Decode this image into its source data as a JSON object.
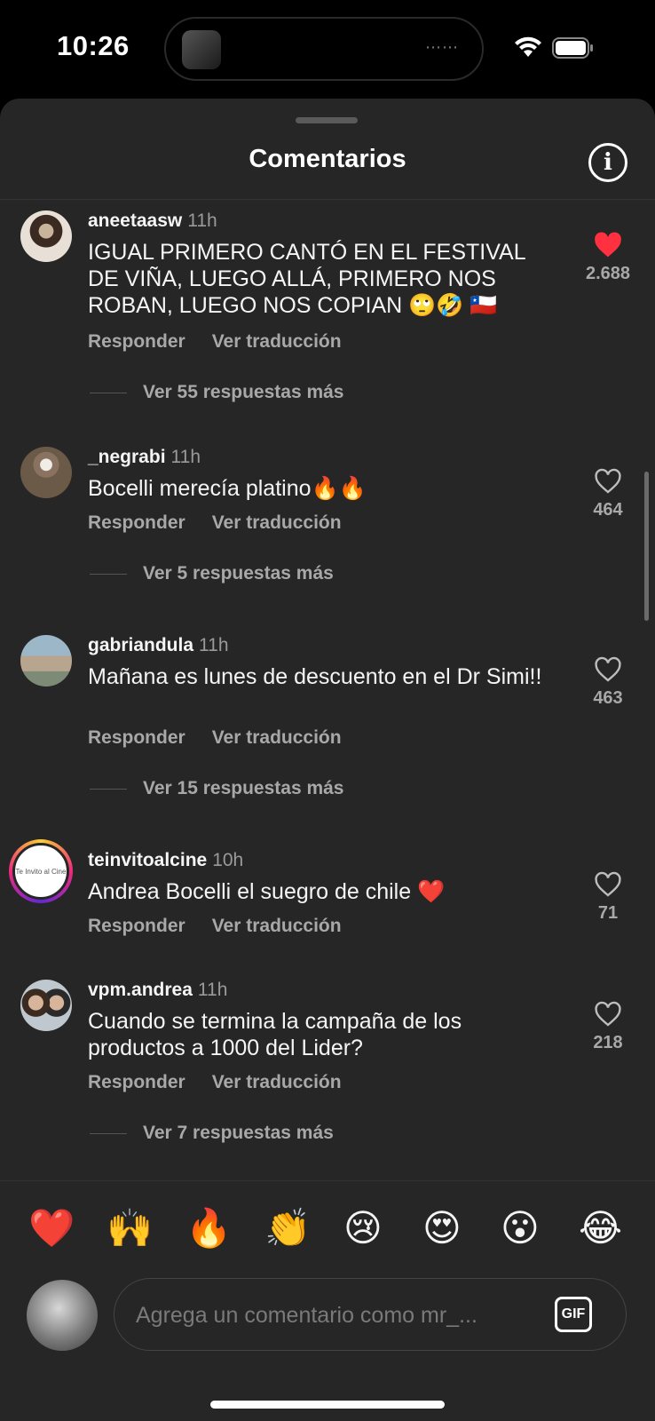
{
  "status": {
    "time": "10:26"
  },
  "sheet": {
    "title": "Comentarios"
  },
  "comments": [
    {
      "username": "aneetaasw",
      "time": "11h",
      "text": "IGUAL PRIMERO CANTÓ EN EL FESTIVAL DE VIÑA, LUEGO ALLÁ, PRIMERO NOS ROBAN, LUEGO NOS COPIAN 🙄🤣 🇨🇱",
      "reply": "Responder",
      "translate": "Ver traducción",
      "replies": "Ver 55 respuestas más",
      "likes": "2.688",
      "liked": true
    },
    {
      "username": "_negrabi",
      "time": "11h",
      "text": "Bocelli merecía platino🔥🔥",
      "reply": "Responder",
      "translate": "Ver traducción",
      "replies": "Ver 5 respuestas más",
      "likes": "464",
      "liked": false
    },
    {
      "username": "gabriandula",
      "time": "11h",
      "text": "Mañana es lunes de descuento en el Dr Simi!!",
      "reply": "Responder",
      "translate": "Ver traducción",
      "replies": "Ver 15 respuestas más",
      "likes": "463",
      "liked": false
    },
    {
      "username": "teinvitoalcine",
      "time": "10h",
      "text": "Andrea Bocelli el suegro de chile ❤️",
      "reply": "Responder",
      "translate": "Ver traducción",
      "likes": "71",
      "liked": false,
      "avatar_text": "Te Invito al Cine"
    },
    {
      "username": "vpm.andrea",
      "time": "11h",
      "text": "Cuando se termina la campaña de  los productos a 1000 del Lider?",
      "reply": "Responder",
      "translate": "Ver traducción",
      "replies": "Ver 7 respuestas más",
      "likes": "218",
      "liked": false
    }
  ],
  "reactions": [
    "❤️",
    "🙌",
    "🔥",
    "👏",
    "😢",
    "😍",
    "😮",
    "😂"
  ],
  "compose": {
    "placeholder": "Agrega un comentario como mr_...",
    "gif_label": "GIF"
  },
  "colors": {
    "sheet_bg": "#262626",
    "liked_heart": "#ff3040",
    "muted_text": "#a8a8a8"
  }
}
